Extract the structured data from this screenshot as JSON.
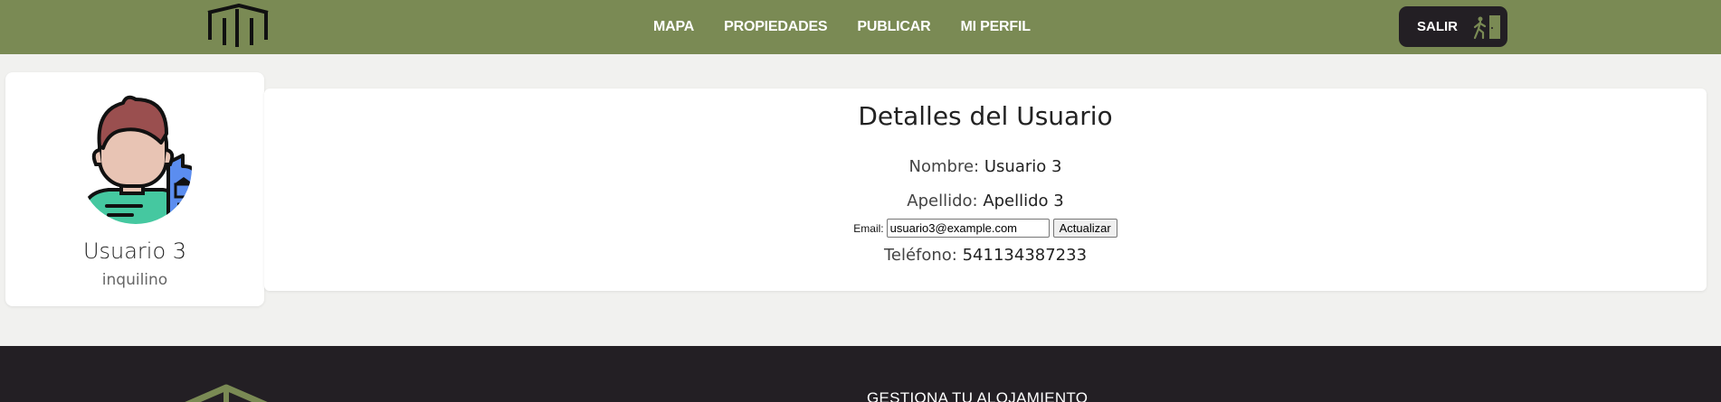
{
  "header": {
    "logo_icon": "building-logo-icon",
    "nav": [
      "MAPA",
      "PROPIEDADES",
      "PUBLICAR",
      "MI PERFIL"
    ],
    "logout_label": "SALIR",
    "logout_icon": "exit-door-icon"
  },
  "profile": {
    "avatar_icon": "user-avatar-icon",
    "name": "Usuario 3",
    "role": "inquilino"
  },
  "details": {
    "title": "Detalles del Usuario",
    "nombre_label": "Nombre:",
    "nombre_value": "Usuario 3",
    "apellido_label": "Apellido:",
    "apellido_value": "Apellido 3",
    "email_label": "Email:",
    "email_value": "usuario3@example.com",
    "update_button": "Actualizar",
    "telefono_label": "Teléfono:",
    "telefono_value": "541134387233"
  },
  "footer": {
    "heading": "GESTIONA TU ALOJAMIENTO",
    "logo_icon": "roof-logo-icon"
  },
  "colors": {
    "header_bg": "#7a8a54",
    "dark": "#231f24",
    "page_bg": "#f1f1ef"
  }
}
